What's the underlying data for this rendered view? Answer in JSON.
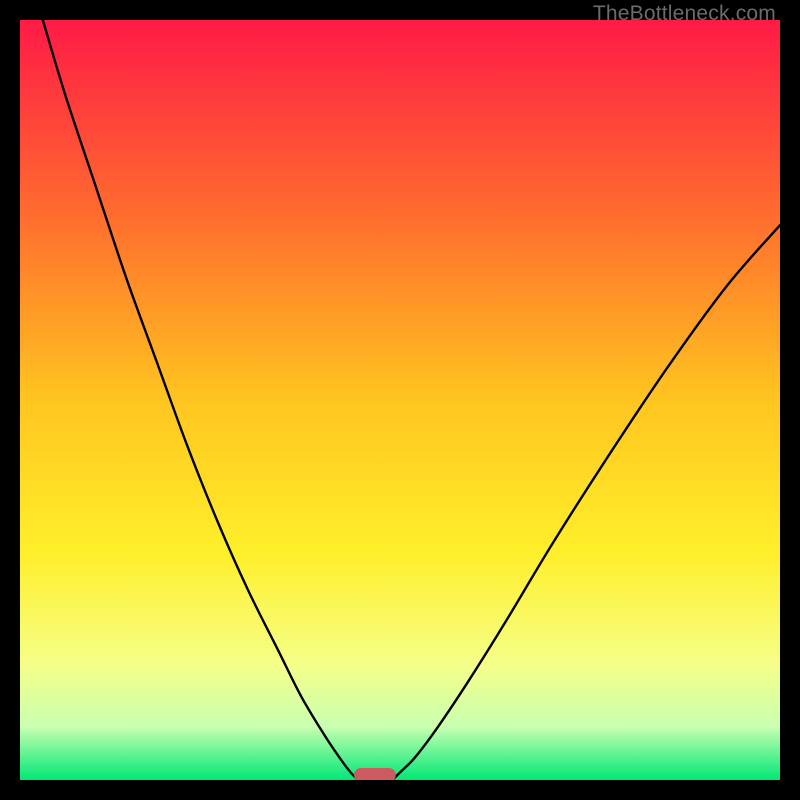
{
  "watermark": "TheBottleneck.com",
  "chart_data": {
    "type": "line",
    "title": "",
    "xlabel": "",
    "ylabel": "",
    "xlim": [
      0,
      100
    ],
    "ylim": [
      0,
      100
    ],
    "grid": false,
    "legend": false,
    "background_gradient": {
      "stops": [
        {
          "offset": 0.0,
          "color": "#ff1a46"
        },
        {
          "offset": 0.25,
          "color": "#ff6a2f"
        },
        {
          "offset": 0.5,
          "color": "#ffc51f"
        },
        {
          "offset": 0.7,
          "color": "#ffef2a"
        },
        {
          "offset": 0.85,
          "color": "#f5ff8a"
        },
        {
          "offset": 0.93,
          "color": "#c8ffb0"
        },
        {
          "offset": 1.0,
          "color": "#00e876"
        }
      ]
    },
    "series": [
      {
        "name": "left-curve",
        "x": [
          3,
          6,
          10,
          14,
          18,
          22,
          26,
          30,
          34,
          37,
          40,
          42,
          43.5,
          44.5
        ],
        "y": [
          100,
          90,
          78,
          66,
          55,
          44,
          34,
          25,
          17,
          11,
          6,
          3,
          1,
          0
        ]
      },
      {
        "name": "right-curve",
        "x": [
          49,
          50,
          52,
          55,
          59,
          64,
          70,
          77,
          85,
          93,
          100
        ],
        "y": [
          0,
          1,
          3,
          7,
          13,
          21,
          31,
          42,
          54,
          65,
          73
        ]
      }
    ],
    "marker": {
      "name": "bottleneck-marker",
      "x_center": 46.7,
      "width": 5.5,
      "color": "#cc5a5f"
    }
  }
}
